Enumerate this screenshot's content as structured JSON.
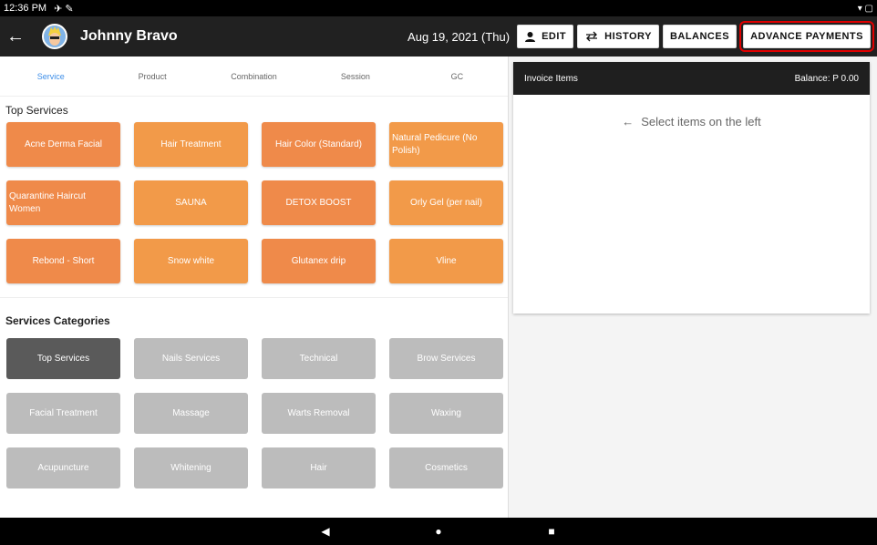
{
  "status_bar": {
    "time": "12:36 PM"
  },
  "app_bar": {
    "user_name": "Johnny Bravo",
    "date": "Aug 19, 2021 (Thu)",
    "buttons": {
      "edit": "EDIT",
      "history": "HISTORY",
      "balances": "BALANCES",
      "advance_payments": "ADVANCE PAYMENTS"
    }
  },
  "tabs": [
    {
      "label": "Service",
      "active": true
    },
    {
      "label": "Product",
      "active": false
    },
    {
      "label": "Combination",
      "active": false
    },
    {
      "label": "Session",
      "active": false
    },
    {
      "label": "GC",
      "active": false
    }
  ],
  "top_services": {
    "title": "Top Services",
    "items": [
      {
        "label": "Acne Derma Facial"
      },
      {
        "label": "Hair Treatment"
      },
      {
        "label": "Hair Color (Standard)"
      },
      {
        "label": "Natural Pedicure (No Polish)"
      },
      {
        "label": "Quarantine Haircut Women"
      },
      {
        "label": "SAUNA"
      },
      {
        "label": "DETOX BOOST"
      },
      {
        "label": "Orly Gel (per nail)"
      },
      {
        "label": "Rebond - Short"
      },
      {
        "label": "Snow white"
      },
      {
        "label": "Glutanex drip"
      },
      {
        "label": "Vline"
      }
    ]
  },
  "service_categories": {
    "title": "Services Categories",
    "items": [
      {
        "label": "Top Services",
        "active": true
      },
      {
        "label": "Nails Services"
      },
      {
        "label": "Technical"
      },
      {
        "label": "Brow Services"
      },
      {
        "label": "Facial Treatment"
      },
      {
        "label": "Massage"
      },
      {
        "label": "Warts Removal"
      },
      {
        "label": "Waxing"
      },
      {
        "label": "Acupuncture"
      },
      {
        "label": "Whitening"
      },
      {
        "label": "Hair"
      },
      {
        "label": "Cosmetics"
      }
    ]
  },
  "invoice": {
    "title": "Invoice Items",
    "balance": "Balance: P 0.00",
    "empty_message": "Select items on the left"
  },
  "colors": {
    "accent": "#3d8ee8",
    "service_orange": "#ef8a4a",
    "service_orange_alt": "#f29a49",
    "category_gray": "#bcbcbc",
    "category_active": "#5a5a5a",
    "highlight_red": "#e00000"
  }
}
